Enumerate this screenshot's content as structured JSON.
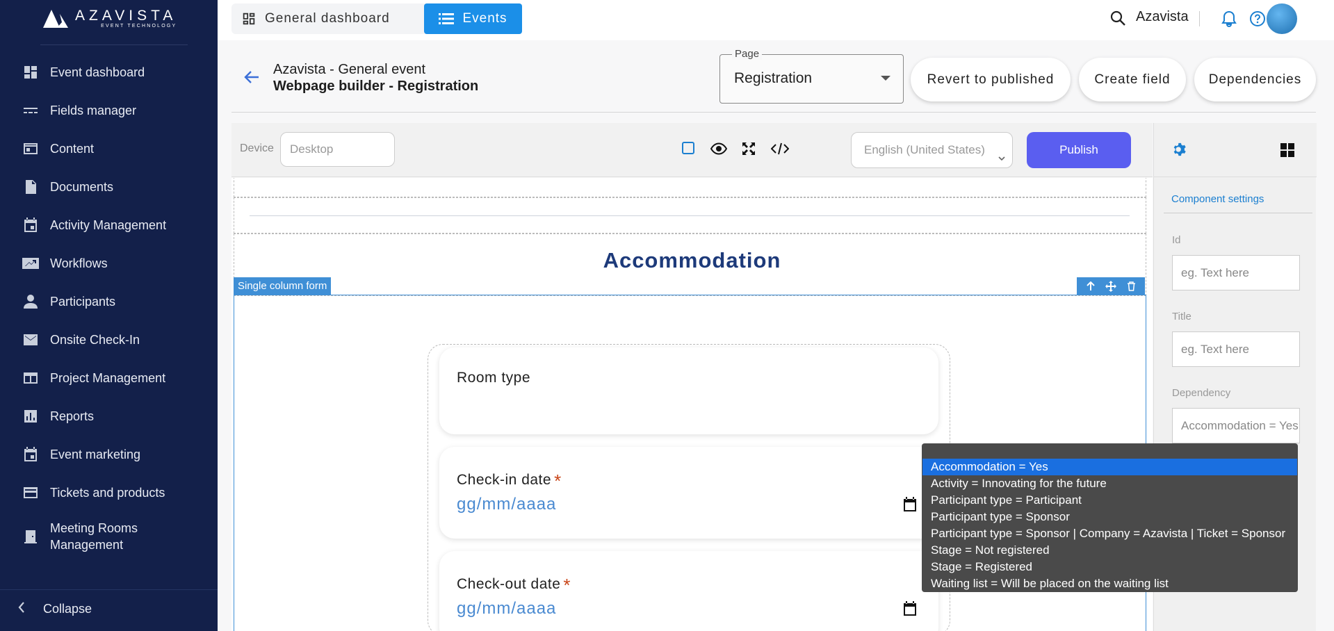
{
  "brand": {
    "name": "AZAVISTA",
    "tagline": "EVENT TECHNOLOGY"
  },
  "sidebar": {
    "items": [
      {
        "label": "Event dashboard",
        "icon": "dashboard-icon"
      },
      {
        "label": "Fields manager",
        "icon": "fields-icon"
      },
      {
        "label": "Content",
        "icon": "content-icon"
      },
      {
        "label": "Documents",
        "icon": "document-icon"
      },
      {
        "label": "Activity Management",
        "icon": "calendar-icon"
      },
      {
        "label": "Workflows",
        "icon": "workflow-icon"
      },
      {
        "label": "Participants",
        "icon": "person-icon"
      },
      {
        "label": "Onsite Check-In",
        "icon": "mail-icon"
      },
      {
        "label": "Project Management",
        "icon": "project-icon"
      },
      {
        "label": "Reports",
        "icon": "chart-icon"
      },
      {
        "label": "Event marketing",
        "icon": "calendar-icon"
      },
      {
        "label": "Tickets and products",
        "icon": "card-icon"
      },
      {
        "label": "Meeting Rooms Management",
        "icon": "door-icon"
      }
    ],
    "collapse_label": "Collapse"
  },
  "topbar": {
    "tab_general": "General dashboard",
    "tab_events": "Events",
    "user_name": "Azavista"
  },
  "header": {
    "event_name": "Azavista - General event",
    "page_title": "Webpage builder - Registration",
    "page_select_label": "Page",
    "page_select_value": "Registration",
    "btn_revert": "Revert to published",
    "btn_create_field": "Create field",
    "btn_dependencies": "Dependencies"
  },
  "toolbar": {
    "device_label": "Device",
    "device_placeholder": "Desktop",
    "language_value": "English (United States)",
    "publish_label": "Publish"
  },
  "canvas": {
    "section_title": "Accommodation",
    "component_label": "Single column form",
    "fields": [
      {
        "label": "Room type",
        "required": false
      },
      {
        "label": "Check-in date",
        "required": true,
        "placeholder": "gg/mm/aaaa"
      },
      {
        "label": "Check-out date",
        "required": true,
        "placeholder": "gg/mm/aaaa"
      }
    ],
    "required_mark": "*"
  },
  "right_panel": {
    "tab_label": "Component settings",
    "id_label": "Id",
    "id_placeholder": "eg. Text here",
    "title_label": "Title",
    "title_placeholder": "eg. Text here",
    "dependency_label": "Dependency",
    "dependency_value": "Accommodation = Yes"
  },
  "dependency_options": [
    "Accommodation = Yes",
    "Activity = Innovating for the future",
    "Participant type = Participant",
    "Participant type = Sponsor",
    "Participant type = Sponsor | Company = Azavista | Ticket = Sponsor",
    "Stage = Not registered",
    "Stage = Registered",
    "Waiting list = Will be placed on the waiting list"
  ],
  "colors": {
    "sidebar_bg": "#13204a",
    "accent_blue": "#1b8fe8",
    "publish": "#5a5ef0",
    "title_navy": "#1d3a7a",
    "selected_option": "#1a6fe0"
  }
}
